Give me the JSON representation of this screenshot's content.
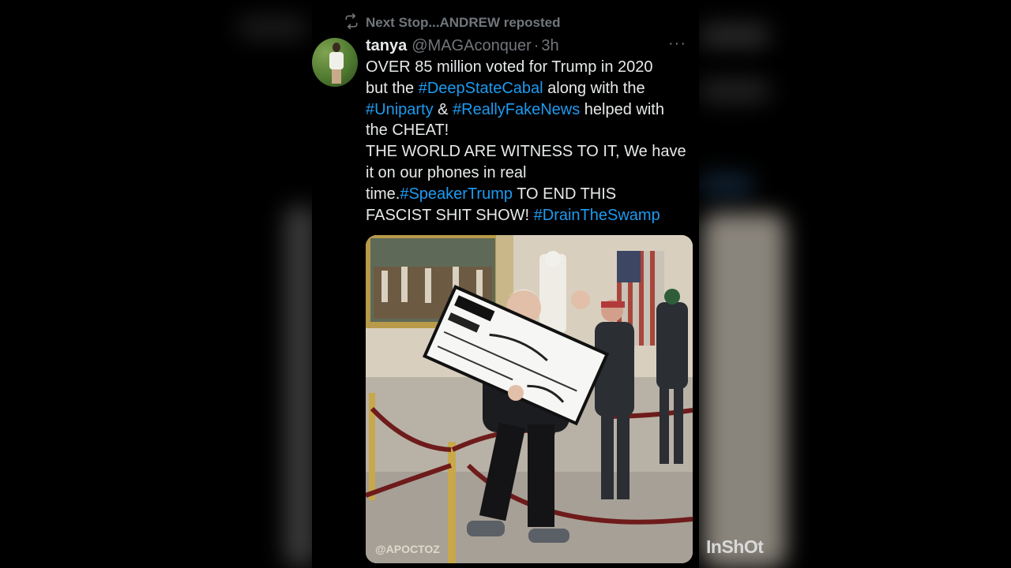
{
  "repost": {
    "icon": "repost-icon",
    "label": "Next Stop...ANDREW reposted"
  },
  "tweet": {
    "author_name": "tanya",
    "author_handle": "@MAGAconquer",
    "separator": "·",
    "time": "3h",
    "more_icon": "more-icon",
    "more_glyph": "···",
    "text": {
      "l1": "OVER 85 million voted for Trump in 2020",
      "l2a": "but the ",
      "tag_deepstate": "#DeepStateCabal",
      "l2b": " along with the",
      "tag_uniparty": "#Uniparty",
      "l3a": " & ",
      "tag_reallyfake": "#ReallyFakeNews",
      "l3b": " helped with",
      "l4": "the CHEAT!",
      "l5": "THE WORLD ARE WITNESS TO IT, We have",
      "l6": "it on our phones in real",
      "l7a": "time.",
      "tag_speaker": "#SpeakerTrump",
      "l7b": " TO END THIS",
      "l8a": "FASCIST SHIT SHOW! ",
      "tag_drain": "#DrainTheSwamp"
    },
    "media": {
      "watermark": "@APOCTOZ"
    }
  },
  "overlay": {
    "inshot_logo": "InShOt"
  },
  "colors": {
    "background": "#000000",
    "text": "#e7e9ea",
    "muted": "#71767b",
    "hashtag": "#1d9bf0"
  }
}
